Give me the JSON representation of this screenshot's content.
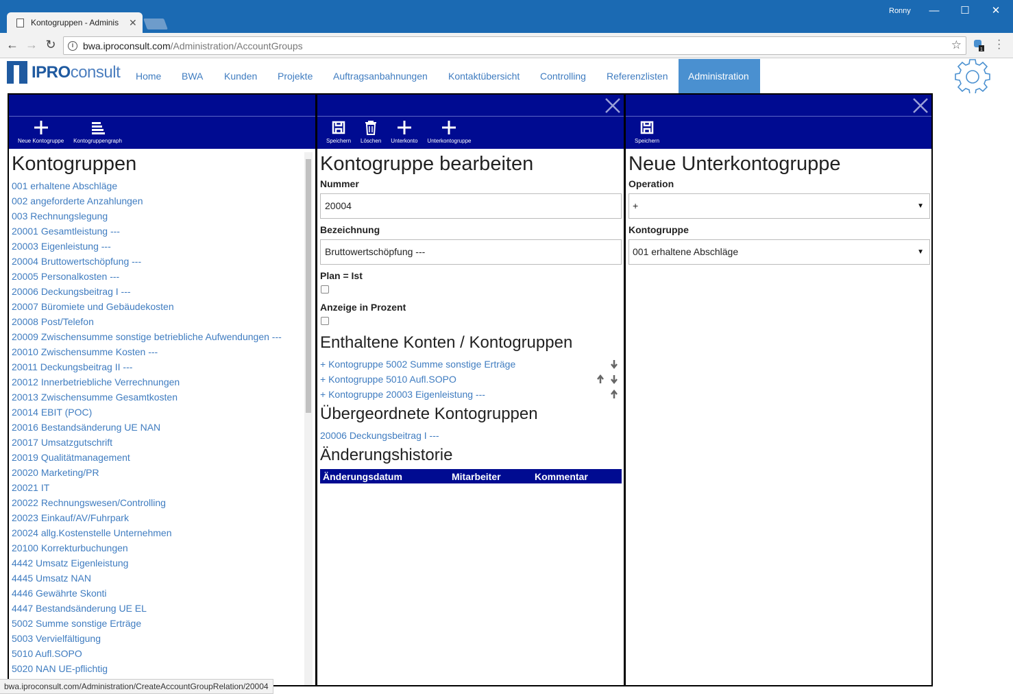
{
  "browser": {
    "tab_title": "Kontogruppen - Adminis",
    "user": "Ronny",
    "url_host": "bwa.iproconsult.com",
    "url_path": "/Administration/AccountGroups",
    "extension_badge": "1",
    "status_url": "bwa.iproconsult.com/Administration/CreateAccountGroupRelation/20004"
  },
  "app": {
    "logo_ipro": "IPRO",
    "logo_consult": "consult",
    "menu": [
      "Home",
      "BWA",
      "Kunden",
      "Projekte",
      "Auftragsanbahnungen",
      "Kontaktübersicht",
      "Controlling",
      "Referenzlisten",
      "Administration"
    ],
    "active_menu": "Administration"
  },
  "left": {
    "tools": [
      "Neue Kontogruppe",
      "Kontogruppengraph"
    ],
    "title": "Kontogruppen",
    "groups": [
      "001 erhaltene Abschläge",
      "002 angeforderte Anzahlungen",
      "003 Rechnungslegung",
      "20001 Gesamtleistung ---",
      "20003 Eigenleistung ---",
      "20004 Bruttowertschöpfung ---",
      "20005 Personalkosten ---",
      "20006 Deckungsbeitrag I ---",
      "20007 Büromiete und Gebäudekosten",
      "20008 Post/Telefon",
      "20009 Zwischensumme sonstige betriebliche Aufwendungen ---",
      "20010 Zwischensumme Kosten ---",
      "20011 Deckungsbeitrag II ---",
      "20012 Innerbetriebliche Verrechnungen",
      "20013 Zwischensumme Gesamtkosten",
      "20014 EBIT (POC)",
      "20016 Bestandsänderung UE NAN",
      "20017 Umsatzgutschrift",
      "20019 Qualitätmanagement",
      "20020 Marketing/PR",
      "20021 IT",
      "20022 Rechnungswesen/Controlling",
      "20023 Einkauf/AV/Fuhrpark",
      "20024 allg.Kostenstelle Unternehmen",
      "20100 Korrekturbuchungen",
      "4442 Umsatz Eigenleistung",
      "4445 Umsatz NAN",
      "4446 Gewährte Skonti",
      "4447 Bestandsänderung UE EL",
      "5002 Summe sonstige Erträge",
      "5003 Vervielfältigung",
      "5010 Aufl.SOPO",
      "5020 NAN UE-pflichtig"
    ]
  },
  "middle": {
    "tools": [
      "Speichern",
      "Löschen",
      "Unterkonto",
      "Unterkontogruppe"
    ],
    "title": "Kontogruppe bearbeiten",
    "nummer_label": "Nummer",
    "nummer_value": "20004",
    "bezeichnung_label": "Bezeichnung",
    "bezeichnung_value": "Bruttowertschöpfung ---",
    "plan_label": "Plan = Ist",
    "prozent_label": "Anzeige in Prozent",
    "contained_title": "Enthaltene Konten / Kontogruppen",
    "contained": [
      "+ Kontogruppe 5002 Summe sonstige Erträge",
      "+ Kontogruppe 5010 Aufl.SOPO",
      "+ Kontogruppe 20003 Eigenleistung ---"
    ],
    "parent_title": "Übergeordnete Kontogruppen",
    "parents": [
      "20006 Deckungsbeitrag I ---"
    ],
    "history_title": "Änderungshistorie",
    "history_columns": [
      "Änderungsdatum",
      "Mitarbeiter",
      "Kommentar"
    ]
  },
  "right": {
    "tools": [
      "Speichern"
    ],
    "title": "Neue Unterkontogruppe",
    "operation_label": "Operation",
    "operation_value": "+",
    "kontogruppe_label": "Kontogruppe",
    "kontogruppe_value": "001 erhaltene Abschläge"
  }
}
